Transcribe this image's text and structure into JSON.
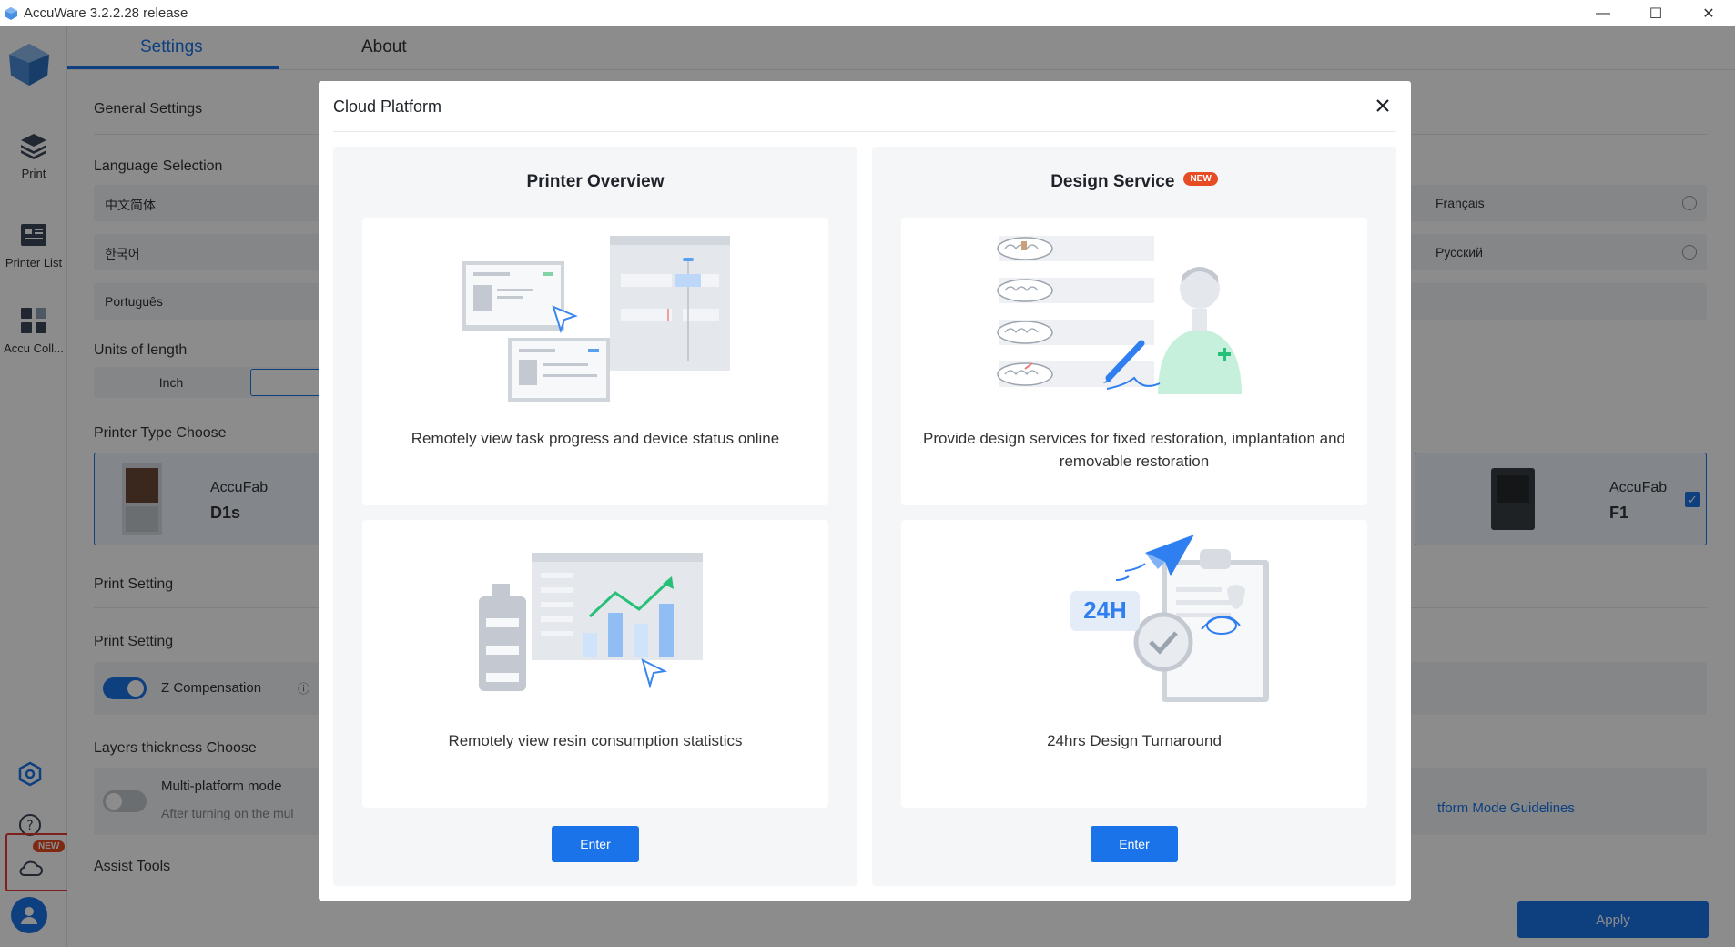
{
  "window": {
    "title": "AccuWare 3.2.2.28 release",
    "minimize": "—",
    "maximize": "☐",
    "close": "✕"
  },
  "sidebar": {
    "items": [
      {
        "label": "Print"
      },
      {
        "label": "Printer List"
      },
      {
        "label": "Accu Coll..."
      }
    ],
    "new_badge": "NEW"
  },
  "tabs": [
    {
      "label": "Settings"
    },
    {
      "label": "About"
    }
  ],
  "settings": {
    "general_title": "General Settings",
    "language_title": "Language Selection",
    "languages": [
      "中文简体",
      "한국어",
      "Português",
      "Français",
      "Русский"
    ],
    "units_title": "Units of length",
    "unit_inch": "Inch",
    "printer_type_title": "Printer Type Choose",
    "printers": [
      {
        "brand": "AccuFab",
        "model": "D1s"
      },
      {
        "brand": "AccuFab",
        "model": "F1"
      }
    ],
    "print_setting_header": "Print Setting",
    "print_setting_sub": "Print Setting",
    "z_compensation": "Z Compensation",
    "layers_title": "Layers thickness Choose",
    "multi_platform": "Multi-platform mode",
    "multi_platform_desc": "After turning on the mul",
    "guidelines_link": "tform Mode Guidelines",
    "assist_tools": "Assist Tools",
    "apply": "Apply"
  },
  "modal": {
    "title": "Cloud Platform",
    "panels": [
      {
        "title": "Printer Overview",
        "cards": [
          {
            "desc": "Remotely view task progress and device status online"
          },
          {
            "desc": "Remotely view resin consumption statistics"
          }
        ],
        "button": "Enter"
      },
      {
        "title": "Design Service",
        "badge": "NEW",
        "cards": [
          {
            "desc": "Provide design services for fixed restoration, implantation and removable restoration"
          },
          {
            "desc": "24hrs Design Turnaround",
            "illus_text": "24H"
          }
        ],
        "button": "Enter"
      }
    ]
  },
  "colors": {
    "accent": "#1a73e8",
    "badge": "#e84c24",
    "highlight_border": "#e53935"
  }
}
